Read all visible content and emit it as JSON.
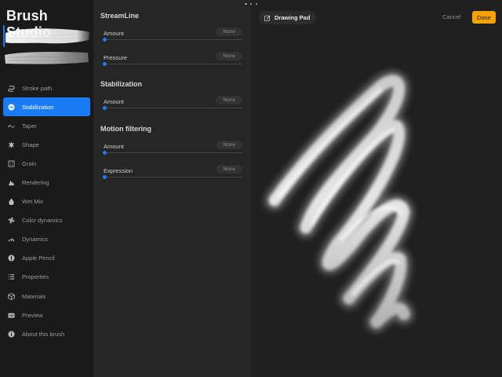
{
  "app": {
    "title": "Brush Studio"
  },
  "colors": {
    "accent": "#1a7cf5",
    "done_bg": "#f5a300"
  },
  "sidebar": {
    "items": [
      {
        "label": "Stroke path",
        "icon": "stroke-path-icon",
        "active": false
      },
      {
        "label": "Stabilization",
        "icon": "stabilization-icon",
        "active": true
      },
      {
        "label": "Taper",
        "icon": "taper-icon",
        "active": false
      },
      {
        "label": "Shape",
        "icon": "shape-icon",
        "active": false
      },
      {
        "label": "Grain",
        "icon": "grain-icon",
        "active": false
      },
      {
        "label": "Rendering",
        "icon": "rendering-icon",
        "active": false
      },
      {
        "label": "Wet Mix",
        "icon": "wet-mix-icon",
        "active": false
      },
      {
        "label": "Color dynamics",
        "icon": "color-dynamics-icon",
        "active": false
      },
      {
        "label": "Dynamics",
        "icon": "dynamics-icon",
        "active": false
      },
      {
        "label": "Apple Pencil",
        "icon": "apple-pencil-icon",
        "active": false
      },
      {
        "label": "Properties",
        "icon": "properties-icon",
        "active": false
      },
      {
        "label": "Materials",
        "icon": "materials-icon",
        "active": false
      },
      {
        "label": "Preview",
        "icon": "preview-icon",
        "active": false
      },
      {
        "label": "About this brush",
        "icon": "info-icon",
        "active": false
      }
    ]
  },
  "settings": {
    "streamline": {
      "title": "StreamLine",
      "amount": {
        "label": "Amount",
        "value": "None",
        "level": 0
      },
      "pressure": {
        "label": "Pressure",
        "value": "None",
        "level": 0
      }
    },
    "stabilization": {
      "title": "Stabilization",
      "amount": {
        "label": "Amount",
        "value": "None",
        "level": 0
      }
    },
    "motion_filtering": {
      "title": "Motion filtering",
      "amount": {
        "label": "Amount",
        "value": "None",
        "level": 0
      },
      "expression": {
        "label": "Expression",
        "value": "None",
        "level": 0
      }
    }
  },
  "canvas": {
    "drawing_pad_label": "Drawing Pad",
    "cancel_label": "Cancel",
    "done_label": "Done"
  }
}
